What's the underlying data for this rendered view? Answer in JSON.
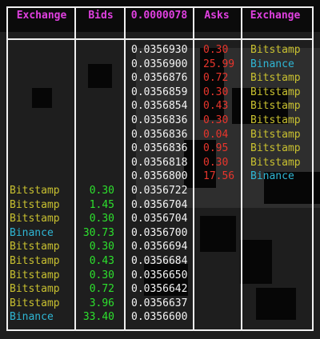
{
  "colors": {
    "header": "#e040e0",
    "bids": "#2de02d",
    "asks": "#e8352c",
    "price": "#f4f4f4",
    "Bitstamp": "#c8c030",
    "Binance": "#2fb6d4",
    "border": "#f0f0f0"
  },
  "headers": {
    "exchange_left": "Exchange",
    "bids": "Bids",
    "mid_price": "0.0000078",
    "asks": "Asks",
    "exchange_right": "Exchange"
  },
  "asks_rows": [
    {
      "price": "0.0356930",
      "ask": "0.30",
      "exchange": "Bitstamp"
    },
    {
      "price": "0.0356900",
      "ask": "25.99",
      "exchange": "Binance"
    },
    {
      "price": "0.0356876",
      "ask": "0.72",
      "exchange": "Bitstamp"
    },
    {
      "price": "0.0356859",
      "ask": "0.30",
      "exchange": "Bitstamp"
    },
    {
      "price": "0.0356854",
      "ask": "0.43",
      "exchange": "Bitstamp"
    },
    {
      "price": "0.0356836",
      "ask": "0.30",
      "exchange": "Bitstamp"
    },
    {
      "price": "0.0356836",
      "ask": "0.04",
      "exchange": "Bitstamp"
    },
    {
      "price": "0.0356836",
      "ask": "0.95",
      "exchange": "Bitstamp"
    },
    {
      "price": "0.0356818",
      "ask": "0.30",
      "exchange": "Bitstamp"
    },
    {
      "price": "0.0356800",
      "ask": "17.56",
      "exchange": "Binance"
    }
  ],
  "bids_rows": [
    {
      "exchange": "Bitstamp",
      "bid": "0.30",
      "price": "0.0356722"
    },
    {
      "exchange": "Bitstamp",
      "bid": "1.45",
      "price": "0.0356704"
    },
    {
      "exchange": "Bitstamp",
      "bid": "0.30",
      "price": "0.0356704"
    },
    {
      "exchange": "Binance",
      "bid": "30.73",
      "price": "0.0356700"
    },
    {
      "exchange": "Bitstamp",
      "bid": "0.30",
      "price": "0.0356694"
    },
    {
      "exchange": "Bitstamp",
      "bid": "0.43",
      "price": "0.0356684"
    },
    {
      "exchange": "Bitstamp",
      "bid": "0.30",
      "price": "0.0356650"
    },
    {
      "exchange": "Bitstamp",
      "bid": "0.72",
      "price": "0.0356642"
    },
    {
      "exchange": "Bitstamp",
      "bid": "3.96",
      "price": "0.0356637"
    },
    {
      "exchange": "Binance",
      "bid": "33.40",
      "price": "0.0356600"
    }
  ]
}
